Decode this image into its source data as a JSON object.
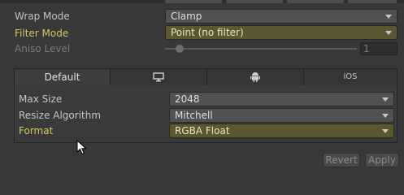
{
  "importer": {
    "wrap_mode": {
      "label": "Wrap Mode",
      "value": "Clamp"
    },
    "filter_mode": {
      "label": "Filter Mode",
      "value": "Point (no filter)"
    },
    "aniso_level": {
      "label": "Aniso Level",
      "value": "1",
      "level_fraction": 0.0
    }
  },
  "platform_tabs": {
    "default_label": "Default",
    "standalone_icon": "monitor-icon",
    "android_icon": "android-icon",
    "ios_label": "iOS"
  },
  "platform_settings": {
    "max_size": {
      "label": "Max Size",
      "value": "2048"
    },
    "resize_algorithm": {
      "label": "Resize Algorithm",
      "value": "Mitchell"
    },
    "format": {
      "label": "Format",
      "value": "RGBA Float"
    }
  },
  "actions": {
    "revert": "Revert",
    "apply": "Apply"
  },
  "colors": {
    "override_label": "#d5c85e",
    "override_field": "#5a5732",
    "background": "#383838"
  }
}
